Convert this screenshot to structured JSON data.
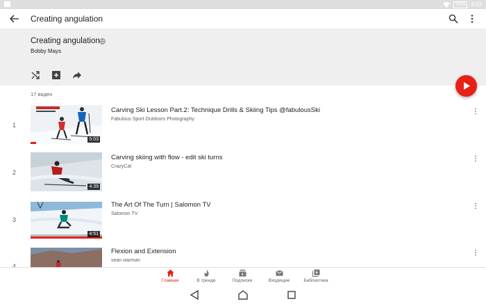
{
  "status": {
    "battery": "53%",
    "time": "8:53"
  },
  "appbar": {
    "title": "Creating angulation"
  },
  "playlist": {
    "title": "Creating angulation",
    "owner": "Bobby Mays",
    "count_label": "17 видео"
  },
  "videos": [
    {
      "index": "1",
      "title": "Carving Ski Lesson Part.2: Technique Drills & Skiing Tips @fabulousSki",
      "channel": "Fabulous Sport Outdoors Photography",
      "duration": "5:03"
    },
    {
      "index": "2",
      "title": "Carving skiing with flow - edit ski turns",
      "channel": "CrazyCat",
      "duration": "4:39"
    },
    {
      "index": "3",
      "title": "The Art Of The Turn | Salomon TV",
      "channel": "Salomon TV",
      "duration": "4:51"
    },
    {
      "index": "4",
      "title": "Flexion and Extension",
      "channel": "sean warman",
      "duration": ""
    }
  ],
  "bottom_nav": [
    {
      "label": "Главная",
      "icon": "home-icon",
      "active": true
    },
    {
      "label": "В тренде",
      "icon": "trending-flame-icon",
      "active": false
    },
    {
      "label": "Подписки",
      "icon": "subscriptions-icon",
      "active": false
    },
    {
      "label": "Входящие",
      "icon": "inbox-mail-icon",
      "active": false
    },
    {
      "label": "Библиотека",
      "icon": "library-icon",
      "active": false
    }
  ],
  "colors": {
    "accent": "#e62117",
    "header_bg": "#efefef",
    "status_bg": "#dedede"
  }
}
